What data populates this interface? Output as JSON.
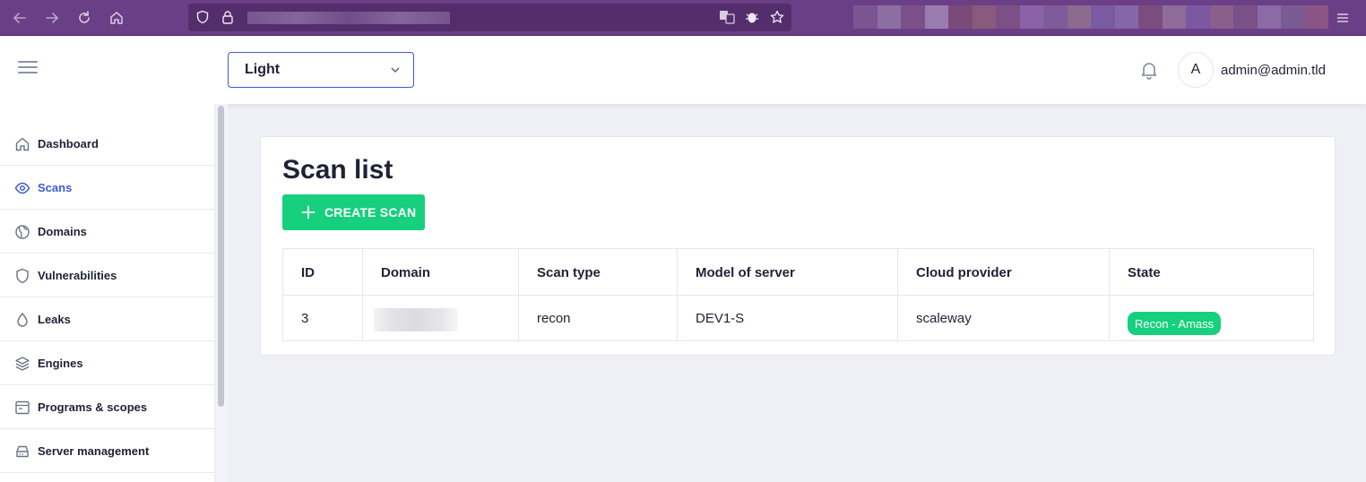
{
  "browser": {
    "nav_icons": [
      "back-icon",
      "forward-icon",
      "reload-icon",
      "home-icon"
    ],
    "url_icons": [
      "shield-icon",
      "lock-icon",
      "translate-icon",
      "bug-icon",
      "star-icon"
    ],
    "menu_icon": "menu-icon",
    "colors": {
      "chrome": "#6b3f86",
      "urlbar": "#542e6c"
    }
  },
  "header": {
    "menu_icon": "hamburger-icon",
    "theme_select": {
      "value": "Light",
      "icon": "chevron-down-icon"
    },
    "notification_icon": "bell-icon",
    "avatar_initial": "A",
    "user_email": "admin@admin.tld"
  },
  "sidebar": {
    "items": [
      {
        "label": "Dashboard",
        "icon": "home-icon",
        "active": false
      },
      {
        "label": "Scans",
        "icon": "eye-icon",
        "active": true
      },
      {
        "label": "Domains",
        "icon": "globe-icon",
        "active": false
      },
      {
        "label": "Vulnerabilities",
        "icon": "shield-icon",
        "active": false
      },
      {
        "label": "Leaks",
        "icon": "droplet-icon",
        "active": false
      },
      {
        "label": "Engines",
        "icon": "layers-icon",
        "active": false
      },
      {
        "label": "Programs & scopes",
        "icon": "browser-icon",
        "active": false
      },
      {
        "label": "Server management",
        "icon": "server-icon",
        "active": false
      }
    ]
  },
  "main": {
    "title": "Scan list",
    "create_button": {
      "label": "CREATE SCAN",
      "icon": "plus-icon"
    },
    "table": {
      "headers": [
        "ID",
        "Domain",
        "Scan type",
        "Model of server",
        "Cloud provider",
        "State"
      ],
      "rows": [
        {
          "id": "3",
          "domain": "",
          "scan_type": "recon",
          "model": "DEV1-S",
          "provider": "scaleway",
          "state": "Recon - Amass"
        }
      ]
    }
  },
  "colors": {
    "accent": "#3d5bd9",
    "success": "#17d07e",
    "background": "#eef0f6"
  }
}
